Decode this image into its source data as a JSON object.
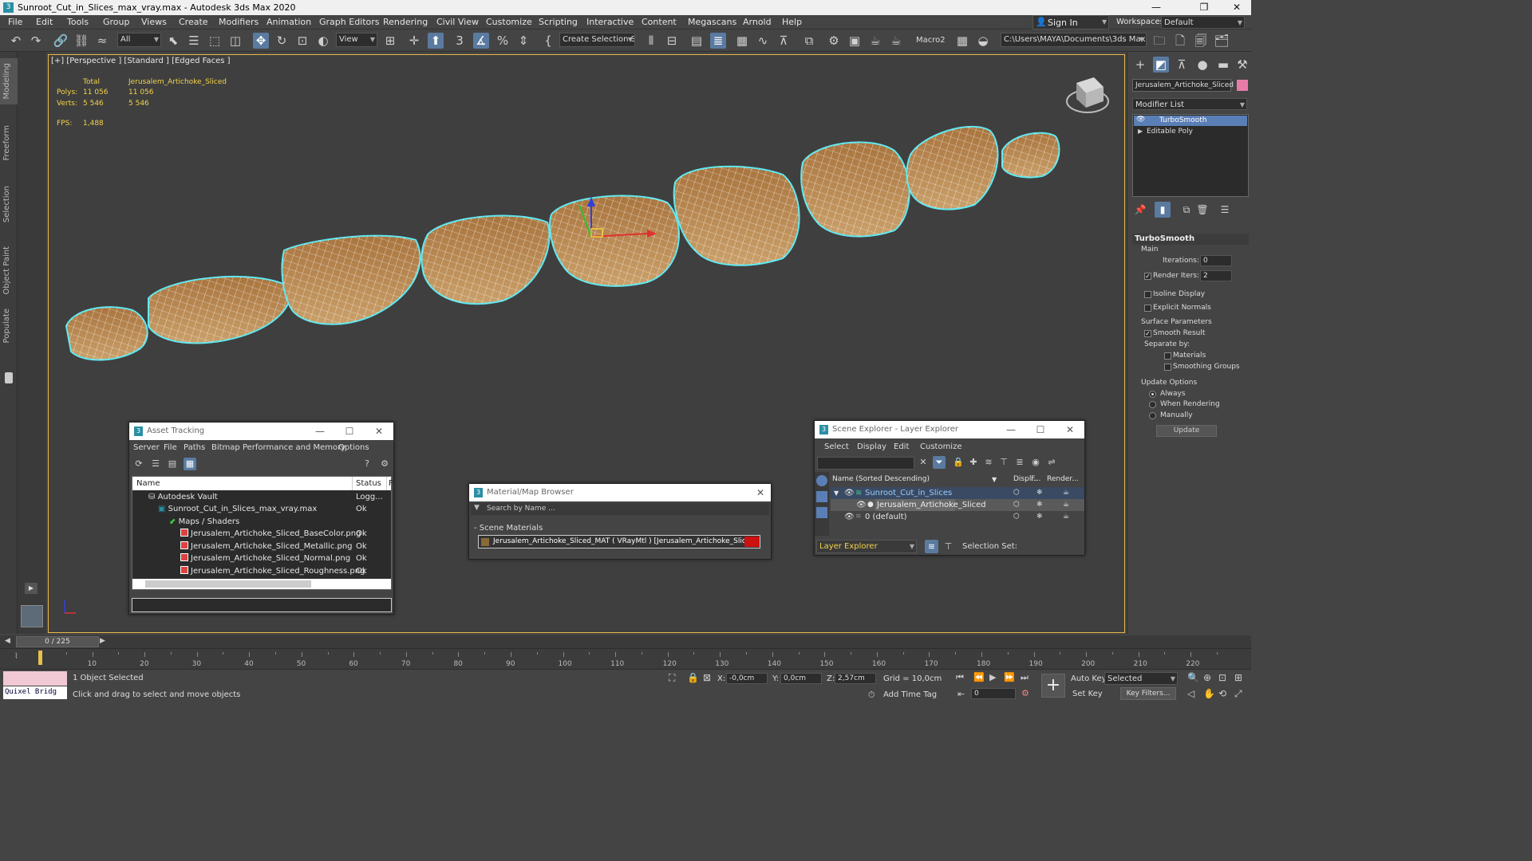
{
  "window": {
    "title": "Sunroot_Cut_in_Slices_max_vray.max - Autodesk 3ds Max 2020",
    "app_icon": "3",
    "minimize": "—",
    "maximize": "❐",
    "close": "✕"
  },
  "menu": [
    "File",
    "Edit",
    "Tools",
    "Group",
    "Views",
    "Create",
    "Modifiers",
    "Animation",
    "Graph Editors",
    "Rendering",
    "Civil View",
    "Customize",
    "Scripting",
    "Interactive",
    "Content",
    "Megascans",
    "Arnold",
    "Help"
  ],
  "account": {
    "sign_in": "Sign In",
    "workspaces_label": "Workspaces:",
    "workspace": "Default"
  },
  "toolbar": {
    "filter": "All",
    "ref_coord": "View",
    "selection_set": "Create Selection Se",
    "macro": "Macro2",
    "project_path": "C:\\Users\\MAYA\\Documents\\3ds Max 2020"
  },
  "left_tabs": [
    "Modeling",
    "Freeform",
    "Selection",
    "Object Paint",
    "Populate"
  ],
  "viewport": {
    "label": "[+] [Perspective ] [Standard ] [Edged Faces ]",
    "stats": {
      "total_label": "Total",
      "object_label": "Jerusalem_Artichoke_Sliced",
      "polys_label": "Polys:",
      "polys_total": "11 056",
      "polys_obj": "11 056",
      "verts_label": "Verts:",
      "verts_total": "5 546",
      "verts_obj": "5 546",
      "fps_label": "FPS:",
      "fps": "1,488"
    }
  },
  "command_panel": {
    "object_name": "Jerusalem_Artichoke_Sliced",
    "object_color": "#e87ca8",
    "modifier_list": "Modifier List",
    "stack": [
      "TurboSmooth",
      "Editable Poly"
    ],
    "rollout_title": "TurboSmooth",
    "main_label": "Main",
    "iterations_label": "Iterations:",
    "iterations": "0",
    "render_iters_label": "Render Iters:",
    "render_iters": "2",
    "isoline": "Isoline Display",
    "explicit_normals": "Explicit Normals",
    "surface_params": "Surface Parameters",
    "smooth_result": "Smooth Result",
    "separate_by": "Separate by:",
    "materials": "Materials",
    "smoothing_groups": "Smoothing Groups",
    "update_options": "Update Options",
    "always": "Always",
    "when_rendering": "When Rendering",
    "manually": "Manually",
    "update_button": "Update"
  },
  "asset_tracking": {
    "title": "Asset Tracking",
    "menu": [
      "Server",
      "File",
      "Paths",
      "Bitmap Performance and Memory",
      "Options"
    ],
    "col_name": "Name",
    "col_status": "Status",
    "col_more": "F",
    "rows": [
      {
        "name": "Autodesk Vault",
        "status": "Logg..."
      },
      {
        "name": "Sunroot_Cut_in_Slices_max_vray.max",
        "status": "Ok"
      },
      {
        "name": "Maps / Shaders",
        "status": ""
      },
      {
        "name": "Jerusalem_Artichoke_Sliced_BaseColor.png",
        "status": "Ok"
      },
      {
        "name": "Jerusalem_Artichoke_Sliced_Metallic.png",
        "status": "Ok"
      },
      {
        "name": "Jerusalem_Artichoke_Sliced_Normal.png",
        "status": "Ok"
      },
      {
        "name": "Jerusalem_Artichoke_Sliced_Roughness.png",
        "status": "Ok"
      }
    ]
  },
  "material_browser": {
    "title": "Material/Map Browser",
    "search_placeholder": "Search by Name ...",
    "section": "- Scene Materials",
    "material": "Jerusalem_Artichoke_Sliced_MAT  ( VRayMtl )  [Jerusalem_Artichoke_Sliced]",
    "swatch_color": "#cc1111"
  },
  "scene_explorer": {
    "title": "Scene Explorer - Layer Explorer",
    "menu": [
      "Select",
      "Display",
      "Edit",
      "Customize"
    ],
    "col_name": "Name (Sorted Descending)",
    "col_display": "Displ...",
    "col_freeze": "F...",
    "col_render": "Render...",
    "rows": [
      {
        "name": "Sunroot_Cut_in_Slices",
        "level": 0
      },
      {
        "name": "Jerusalem_Artichoke_Sliced",
        "level": 1
      },
      {
        "name": "0 (default)",
        "level": 0
      }
    ],
    "footer_dropdown": "Layer Explorer",
    "selection_set_label": "Selection Set:"
  },
  "timeline": {
    "frame": "0 / 225",
    "progress": 0.0,
    "ticks": [
      10,
      20,
      30,
      40,
      50,
      60,
      70,
      80,
      90,
      100,
      110,
      120,
      130,
      140,
      150,
      160,
      170,
      180,
      190,
      200,
      210,
      220
    ],
    "total": 225
  },
  "status": {
    "quixel": "Quixel Bridg",
    "selected_count": "1 Object Selected",
    "prompt": "Click and drag to select and move objects",
    "x_label": "X:",
    "x": "-0,0cm",
    "y_label": "Y:",
    "y": "0,0cm",
    "z_label": "Z:",
    "z": "2,57cm",
    "grid": "Grid = 10,0cm",
    "add_time_tag": "Add Time Tag",
    "auto_key": "Auto Key",
    "set_key": "Set Key",
    "key_mode": "Selected",
    "key_filters": "Key Filters...",
    "current_frame": "0"
  }
}
